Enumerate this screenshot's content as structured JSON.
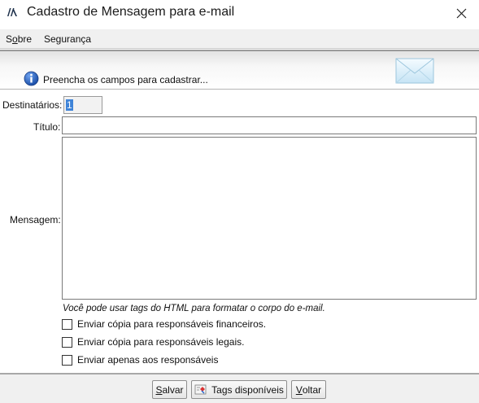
{
  "window": {
    "title": "Cadastro de Mensagem para e-mail"
  },
  "menu": {
    "sobre_first": "S",
    "sobre_underlined": "o",
    "sobre_rest": "bre",
    "seguranca": "Segurança"
  },
  "banner": {
    "text": "Preencha os campos para cadastrar..."
  },
  "form": {
    "destinatarios_label": "Destinatários:",
    "destinatarios_value": "1",
    "titulo_label": "Título:",
    "titulo_value": "",
    "mensagem_label": "Mensagem:",
    "mensagem_value": "",
    "hint": "Você pode usar tags do HTML para formatar o corpo do e-mail.",
    "checkboxes": [
      {
        "label": "Enviar cópia para responsáveis financeiros.",
        "checked": false
      },
      {
        "label": "Enviar cópia para responsáveis legais.",
        "checked": false
      },
      {
        "label": "Enviar apenas aos responsáveis",
        "checked": false
      }
    ]
  },
  "buttons": {
    "salvar_underlined": "S",
    "salvar_rest": "alvar",
    "tags": "Tags disponíveis",
    "voltar_underlined": "V",
    "voltar_rest": "oltar"
  },
  "icons": {
    "app": "app-logo-icon",
    "close": "close-icon",
    "info": "info-icon",
    "envelope": "envelope-icon",
    "tags": "tags-icon"
  },
  "colors": {
    "selection": "#3f84d8",
    "info_blue": "#1f5fbf"
  }
}
